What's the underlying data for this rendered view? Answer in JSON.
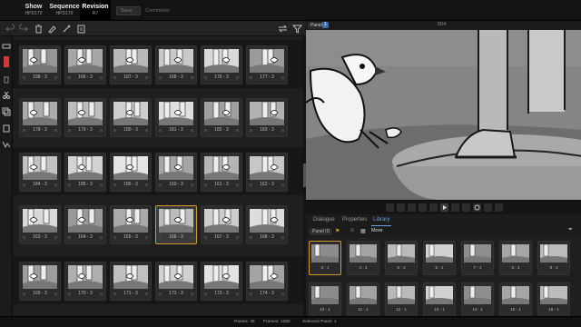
{
  "header": {
    "tabs": [
      {
        "title": "Show",
        "subtitle": "HPD170"
      },
      {
        "title": "Sequence",
        "subtitle": "HPD170"
      },
      {
        "title": "Revision",
        "subtitle": "R7"
      }
    ],
    "save_label": "Save",
    "comments_placeholder": "Comments"
  },
  "grid": {
    "rows": [
      [
        "158 - 3",
        "166 - 3",
        "167 - 3",
        "168 - 3",
        "176 - 3",
        "177 - 3"
      ],
      [
        "178 - 3",
        "179 - 3",
        "180 - 3",
        "181 - 3",
        "182 - 3",
        "183 - 3"
      ],
      [
        "184 - 3",
        "185 - 3",
        "186 - 3",
        "160 - 3",
        "161 - 3",
        "162 - 3"
      ],
      [
        "163 - 3",
        "164 - 3",
        "165 - 3",
        "166 - 3",
        "167 - 3",
        "168 - 3"
      ],
      [
        "169 - 3",
        "170 - 3",
        "171 - 3",
        "172 - 3",
        "173 - 3",
        "174 - 3"
      ]
    ],
    "selected_label": "166 - 3"
  },
  "viewer": {
    "panel_tag": "Panel",
    "panel_count": "1",
    "panel_number": "504"
  },
  "library": {
    "tabs": [
      "Dialogue",
      "Properties",
      "Library"
    ],
    "active_tab": "Library",
    "filter_label": "Panel ID",
    "more_label": "More",
    "row1": [
      "3 - 1",
      "4 - 1",
      "5 - 1",
      "6 - 1",
      "7 - 1",
      "8 - 1",
      "9 - 1"
    ],
    "row2": [
      "10 - 1",
      "11 - 1",
      "12 - 1",
      "13 - 1",
      "14 - 1",
      "15 - 1",
      "16 - 1"
    ]
  },
  "status": {
    "panels": "Panels: 45",
    "frames": "Frames: 1080",
    "selected": "Selected Panel: 1"
  },
  "colors": {
    "accent_selected": "#d49b2a",
    "accent_tab": "#6aa0e0",
    "record_red": "#d23a3a"
  },
  "icons": [
    "undo-icon",
    "redo-icon",
    "trash-icon",
    "pencil-icon",
    "brush-icon",
    "note-icon",
    "swap-icon",
    "filter-icon",
    "play-icon",
    "loop-icon"
  ]
}
